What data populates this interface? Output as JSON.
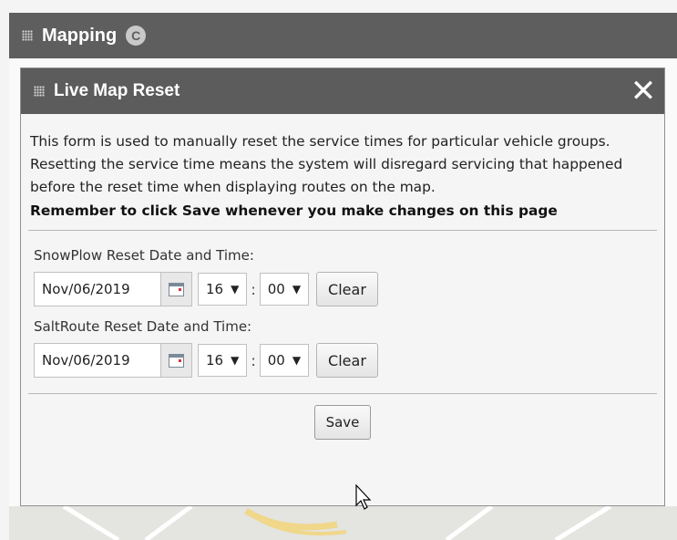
{
  "outer": {
    "title": "Mapping",
    "collapse_icon": "c-circle-icon"
  },
  "panel": {
    "title": "Live Map Reset",
    "close_icon": "close-icon",
    "description": "This form is used to manually reset the service times for particular vehicle groups. Resetting the service time means the system will disregard servicing that happened before the reset time when displaying routes on the map.",
    "reminder": "Remember to click Save whenever you make changes on this page"
  },
  "snowplow": {
    "label": "SnowPlow Reset Date and Time:",
    "date": "Nov/06/2019",
    "hour": "16",
    "minute": "00",
    "clear_label": "Clear"
  },
  "saltroute": {
    "label": "SaltRoute Reset Date and Time:",
    "date": "Nov/06/2019",
    "hour": "16",
    "minute": "00",
    "clear_label": "Clear"
  },
  "actions": {
    "save_label": "Save"
  },
  "symbols": {
    "arrow": "▼",
    "colon": ":",
    "close": "✕"
  },
  "colors": {
    "header_bg": "#5e5e5e",
    "panel_header_bg": "#5c5c5c",
    "panel_bg": "#f5f5f5"
  }
}
